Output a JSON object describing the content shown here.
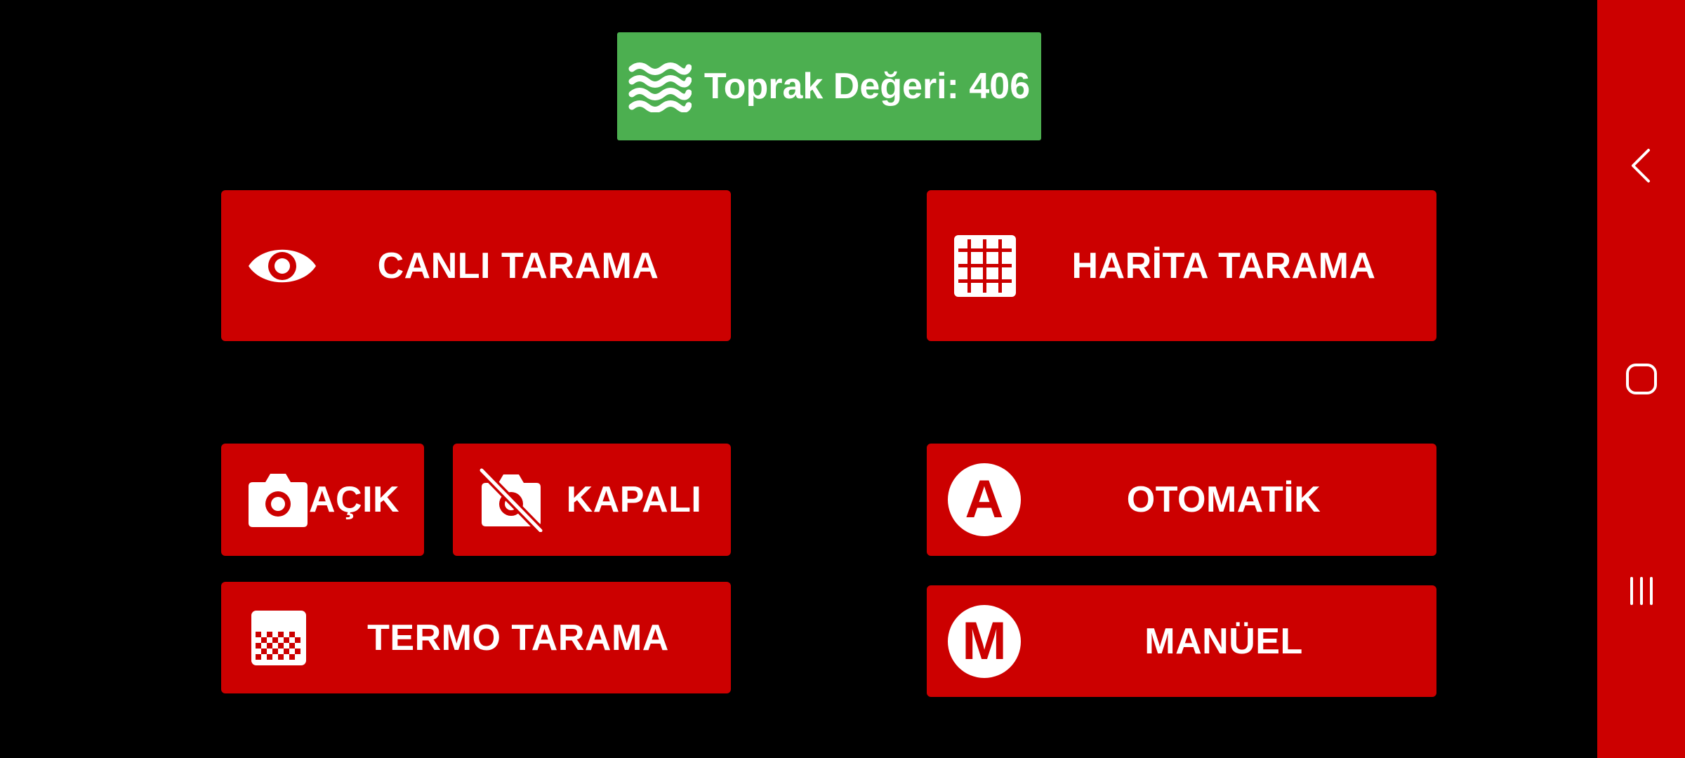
{
  "soil": {
    "label": "Toprak Değeri: 406",
    "icon": "waves-icon",
    "color": "#4caf50"
  },
  "buttons": {
    "canli": {
      "label": "CANLI TARAMA",
      "icon": "eye-icon"
    },
    "harita": {
      "label": "HARİTA TARAMA",
      "icon": "grid-icon"
    },
    "acik": {
      "label": "AÇIK",
      "icon": "camera-icon"
    },
    "kapali": {
      "label": "KAPALI",
      "icon": "camera-off-icon"
    },
    "otomatik": {
      "label": "OTOMATİK",
      "icon": "letter-a-icon",
      "letter": "A"
    },
    "termo": {
      "label": "TERMO TARAMA",
      "icon": "thermal-grid-icon"
    },
    "manuel": {
      "label": "MANÜEL",
      "icon": "letter-m-icon",
      "letter": "M"
    }
  },
  "navbar": {
    "items": [
      "back-icon",
      "home-icon",
      "recent-apps-icon"
    ]
  },
  "colors": {
    "background": "#000000",
    "button": "#cc0000",
    "badge": "#4caf50",
    "text": "#ffffff"
  }
}
